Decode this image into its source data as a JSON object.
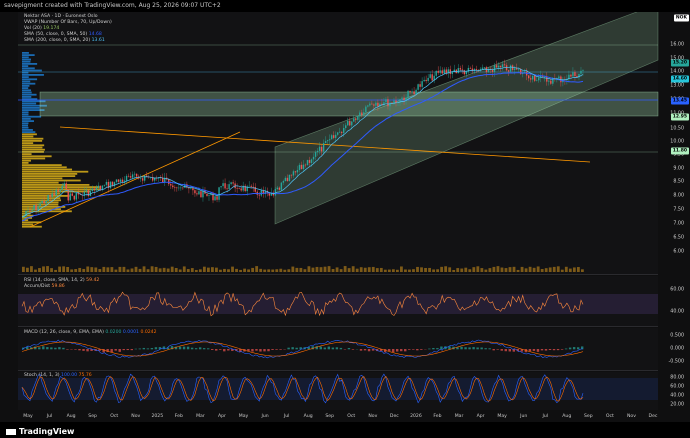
{
  "header": {
    "caption": "savepigment created with TradingView.com, Aug 25, 2026 09:07 UTC+2"
  },
  "legend": {
    "symbol": "Nektar ASA · 1D · Euronext Oslo",
    "vwap": "VWAP (Number Of Bars, 70, Up/Down)",
    "vol": "Vol (20)",
    "vol_value": "19.174",
    "sma50": "SMA (50, close, 0, SMA, 50)",
    "sma50_value": "14.68",
    "sma200": "SMA (200, close, 0, SMA, 20)",
    "sma200_value": "13.61"
  },
  "price_axis": {
    "ticks": [
      "16.00",
      "15.00",
      "14.00",
      "13.00",
      "12.00",
      "11.00",
      "10.50",
      "10.00",
      "9.50",
      "9.00",
      "8.50",
      "8.00",
      "7.50",
      "7.00",
      "6.50",
      "6.00"
    ],
    "badges": [
      {
        "label": "NOK",
        "color": "#ffffff"
      },
      {
        "label": "15.20",
        "color": "#26a69a"
      },
      {
        "label": "14.60",
        "color": "#26c6da"
      },
      {
        "label": "13.45",
        "color": "#2962ff"
      },
      {
        "label": "12.95",
        "color": "#b0f0c0"
      },
      {
        "label": "11.80",
        "color": "#b0f0c0"
      }
    ]
  },
  "rsi": {
    "legend": "RSI (14, close, SMA, 14, 2)",
    "legend_value": "59.42",
    "sub": "Accum/Dist",
    "sub_value": "59.86",
    "ticks": [
      "60.00",
      "40.00"
    ]
  },
  "macd": {
    "legend": "MACD (12, 26, close, 9, EMA, EMA)",
    "v1": "0.0200",
    "v2": "0.0001",
    "v3": "0.0242",
    "ticks": [
      "0.500",
      "0.000",
      "-0.500"
    ]
  },
  "stoch": {
    "legend": "Stoch (14, 1, 3)",
    "v1": "100.00",
    "v2": "75.76",
    "ticks": [
      "80.00",
      "60.00",
      "40.00",
      "20.00"
    ]
  },
  "xaxis": {
    "labels": [
      "May",
      "Jul",
      "Aug",
      "Sep",
      "Oct",
      "Nov",
      "2025",
      "Feb",
      "Mar",
      "Apr",
      "May",
      "Jun",
      "Jul",
      "Aug",
      "Sep",
      "Oct",
      "Nov",
      "Dec",
      "2026",
      "Feb",
      "Mar",
      "Apr",
      "May",
      "Jun",
      "Jul",
      "Aug",
      "Sep",
      "Oct",
      "Nov",
      "Dec"
    ]
  },
  "footer": {
    "brand": "TradingView"
  },
  "colors": {
    "up": "#26a69a",
    "down": "#ef5350",
    "sma50": "#2f5bff",
    "sma200": "#4fc3f7",
    "channel": "#b7f7c4",
    "trend": "#ff9800",
    "rsi": "#ff8a3d",
    "macd": "#2962ff",
    "signal": "#ff6d00",
    "stoch_k": "#2962ff",
    "stoch_d": "#ff6d00"
  }
}
